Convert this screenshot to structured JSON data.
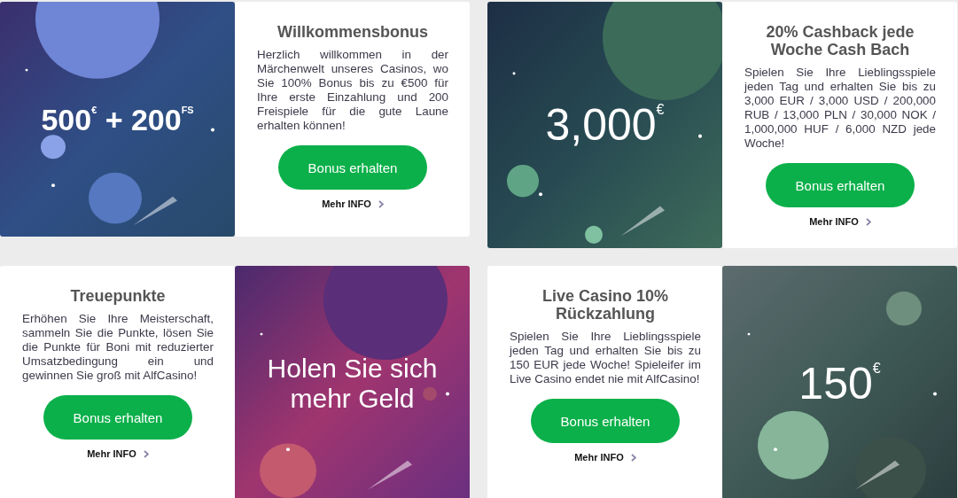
{
  "promos": [
    {
      "image_first": true,
      "art": {
        "kind": "blue",
        "banner": "500$^{€}$ + 200$^{FS}$"
      },
      "title": "Willkommensbonus",
      "text": "Herzlich willkommen in der Märchenwelt unseres Casinos, wo Sie 100% Bonus bis zu €500 für Ihre erste Einzahlung und 200 Freispiele für die gute Laune erhalten können!",
      "button": "Bonus erhalten",
      "link": "Mehr INFO"
    },
    {
      "image_first": true,
      "art": {
        "kind": "green",
        "banner": "3,000$^{€}$"
      },
      "title": "20% Cashback jede Woche Cash Bach",
      "text": "Spielen Sie Ihre Lieblingsspiele jeden Tag und erhalten Sie bis zu 3,000 EUR / 3,000 USD / 200,000 RUB / 13,000 PLN / 30,000 NOK / 1,000,000 HUF / 6,000 NZD jede Woche!",
      "button": "Bonus erhalten",
      "link": "Mehr INFO"
    },
    {
      "image_first": false,
      "art": {
        "kind": "magenta",
        "banner": "Holen Sie sich mehr Geld"
      },
      "title": "Treuepunkte",
      "text": "Erhöhen Sie Ihre Meisterschaft, sammeln Sie die Punkte, lösen Sie die Punkte für Boni mit reduzierter Umsatzbedingung ein und gewinnen Sie groß mit AlfCasino!",
      "button": "Bonus erhalten",
      "link": "Mehr INFO"
    },
    {
      "image_first": false,
      "art": {
        "kind": "sage",
        "banner": "150$^{€}$"
      },
      "title": "Live Casino 10% Rückzahlung",
      "text": "Spielen Sie Ihre Lieblingsspiele jeden Tag und erhalten Sie bis zu 150 EUR jede Woche! Spieleifer im Live Casino endet nie mit AlfCasino!",
      "button": "Bonus erhalten",
      "link": "Mehr INFO"
    }
  ]
}
